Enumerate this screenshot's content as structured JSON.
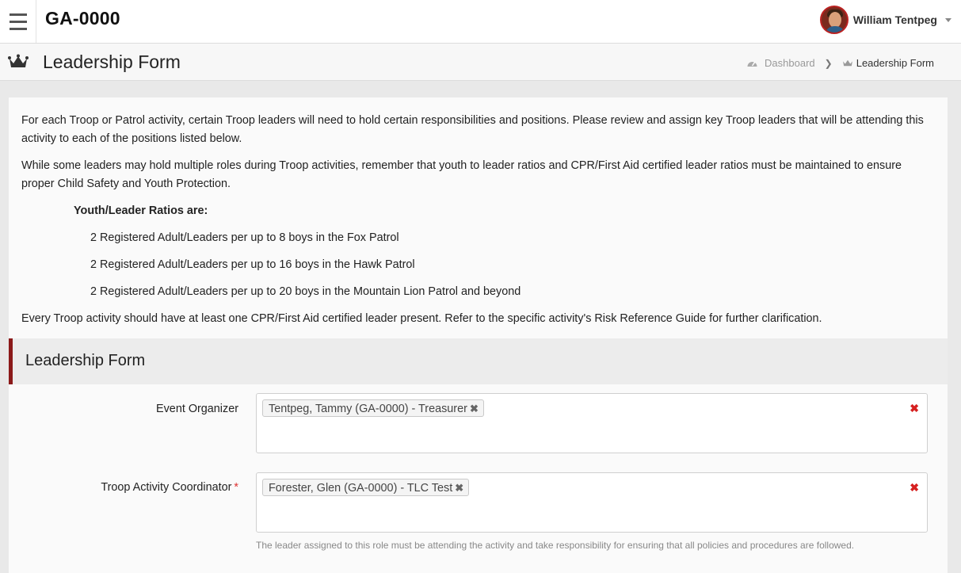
{
  "navbar": {
    "brand": "GA-0000",
    "user_name": "William Tentpeg"
  },
  "header": {
    "title": "Leadership Form",
    "breadcrumb": {
      "home": "Dashboard",
      "current": "Leadership Form"
    }
  },
  "intro": {
    "p1": "For each Troop or Patrol activity, certain Troop leaders will need to hold certain responsibilities and positions. Please review and assign key Troop leaders that will be attending this activity to each of the positions listed below.",
    "p2": "While some leaders may hold multiple roles during Troop activities, remember that youth to leader ratios and CPR/First Aid certified leader ratios must be maintained to ensure proper Child Safety and Youth Protection.",
    "ratios_heading": "Youth/Leader Ratios are:",
    "ratios": [
      "2 Registered Adult/Leaders per up to 8 boys in the Fox Patrol",
      "2 Registered Adult/Leaders per up to 16 boys in the Hawk Patrol",
      "2 Registered Adult/Leaders per up to 20 boys in the Mountain Lion Patrol and beyond"
    ],
    "p3": "Every Troop activity should have at least one CPR/First Aid certified leader present. Refer to the specific activity's Risk Reference Guide for further clarification."
  },
  "form": {
    "section_title": "Leadership Form",
    "fields": [
      {
        "label": "Event Organizer",
        "required": false,
        "selected": "Tentpeg, Tammy (GA-0000) - Treasurer",
        "help": ""
      },
      {
        "label": "Troop Activity Coordinator",
        "required": true,
        "required_mark": "*",
        "selected": "Forester, Glen (GA-0000) - TLC Test",
        "help": "The leader assigned to this role must be attending the activity and take responsibility for ensuring that all policies and procedures are followed."
      }
    ],
    "remove_glyph": "✖",
    "clear_glyph": "✖"
  },
  "colors": {
    "accent": "#8b1a1a",
    "clear": "#d62020"
  }
}
